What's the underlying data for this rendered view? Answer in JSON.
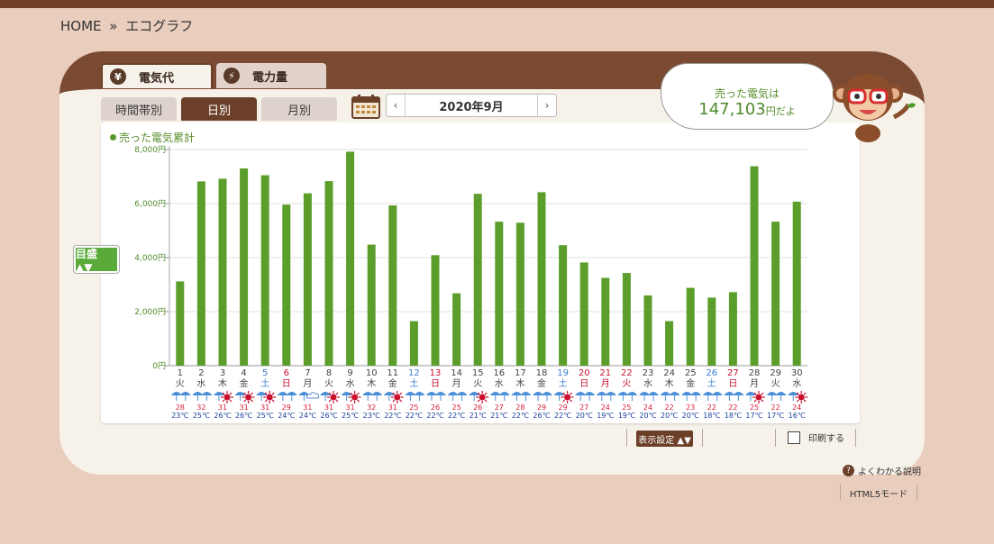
{
  "breadcrumb": {
    "home": "HOME",
    "sep": "»",
    "current": "エコグラフ"
  },
  "main_tabs": [
    {
      "label": "電気代",
      "icon": "yen-icon",
      "icon_glyph": "¥",
      "active": true
    },
    {
      "label": "電力量",
      "icon": "lightning-icon",
      "icon_glyph": "⚡",
      "active": false
    }
  ],
  "sub_tabs": [
    {
      "label": "時間帯別",
      "active": false
    },
    {
      "label": "日別",
      "active": true
    },
    {
      "label": "月別",
      "active": false
    }
  ],
  "date_nav": {
    "prev": "‹",
    "next": "›",
    "label": "2020年9月"
  },
  "summary": {
    "line1": "売った電気は",
    "value": "147,103",
    "unit": "円だよ"
  },
  "scale_button": "目盛 ▲▼",
  "legend": "売った電気累計",
  "controls": {
    "display_settings": "表示設定 ▲▼",
    "print": "印刷する",
    "help": "よくわかる説明",
    "html5": "HTML5モード"
  },
  "colors": {
    "bar": "#5b9e2c",
    "brown": "#6b3f28",
    "sat": "#3a7fd0",
    "sun": "#c8102e",
    "rain": "#4a8fd8",
    "max": "#d81e3a",
    "min": "#1a3f9e"
  },
  "chart_data": {
    "type": "bar",
    "ylabel": "",
    "ylim": [
      0,
      8000
    ],
    "yticks": [
      "0円",
      "2,000円",
      "4,000円",
      "6,000円",
      "8,000円"
    ],
    "ytick_values": [
      0,
      2000,
      4000,
      6000,
      8000
    ],
    "categories": [
      "1",
      "2",
      "3",
      "4",
      "5",
      "6",
      "7",
      "8",
      "9",
      "10",
      "11",
      "12",
      "13",
      "14",
      "15",
      "16",
      "17",
      "18",
      "19",
      "20",
      "21",
      "22",
      "23",
      "24",
      "25",
      "26",
      "27",
      "28",
      "29",
      "30"
    ],
    "weekdays": [
      "火",
      "水",
      "木",
      "金",
      "土",
      "日",
      "月",
      "火",
      "水",
      "木",
      "金",
      "土",
      "日",
      "月",
      "火",
      "水",
      "木",
      "金",
      "土",
      "日",
      "月",
      "火",
      "水",
      "木",
      "金",
      "土",
      "日",
      "月",
      "火",
      "水"
    ],
    "day_type": [
      "w",
      "w",
      "w",
      "w",
      "sat",
      "sun",
      "w",
      "w",
      "w",
      "w",
      "w",
      "sat",
      "sun",
      "w",
      "w",
      "w",
      "w",
      "w",
      "sat",
      "sun",
      "sun",
      "sun",
      "w",
      "w",
      "w",
      "sat",
      "sun",
      "w",
      "w",
      "w"
    ],
    "weather": [
      "rain",
      "rain",
      "sunrain",
      "sunrain",
      "sunrain",
      "rain",
      "cloudrain",
      "sunrain",
      "sunrain",
      "rain",
      "sunrain",
      "rain",
      "rain",
      "rain",
      "sunrain",
      "rain",
      "rain",
      "rain",
      "sunrain",
      "rain",
      "rain",
      "rain",
      "rain",
      "rain",
      "rain",
      "rain",
      "rain",
      "sunrain",
      "rain",
      "sunrain"
    ],
    "temp_max": [
      28,
      32,
      31,
      31,
      31,
      29,
      31,
      31,
      31,
      32,
      31,
      25,
      26,
      25,
      26,
      27,
      28,
      29,
      29,
      27,
      24,
      25,
      24,
      22,
      23,
      22,
      22,
      25,
      22,
      24
    ],
    "temp_min": [
      23,
      25,
      26,
      26,
      25,
      24,
      24,
      26,
      25,
      23,
      22,
      22,
      22,
      22,
      21,
      21,
      22,
      26,
      22,
      20,
      19,
      19,
      20,
      20,
      20,
      18,
      18,
      17,
      17,
      16
    ],
    "series": [
      {
        "values": [
          3120,
          6820,
          6920,
          7300,
          7050,
          5960,
          6380,
          6830,
          7920,
          4480,
          5930,
          1650,
          4090,
          2680,
          6360,
          5330,
          5290,
          6420,
          4460,
          3820,
          3250,
          3430,
          2600,
          1650,
          2880,
          2520,
          2720,
          7380,
          5330,
          6070
        ]
      }
    ]
  }
}
